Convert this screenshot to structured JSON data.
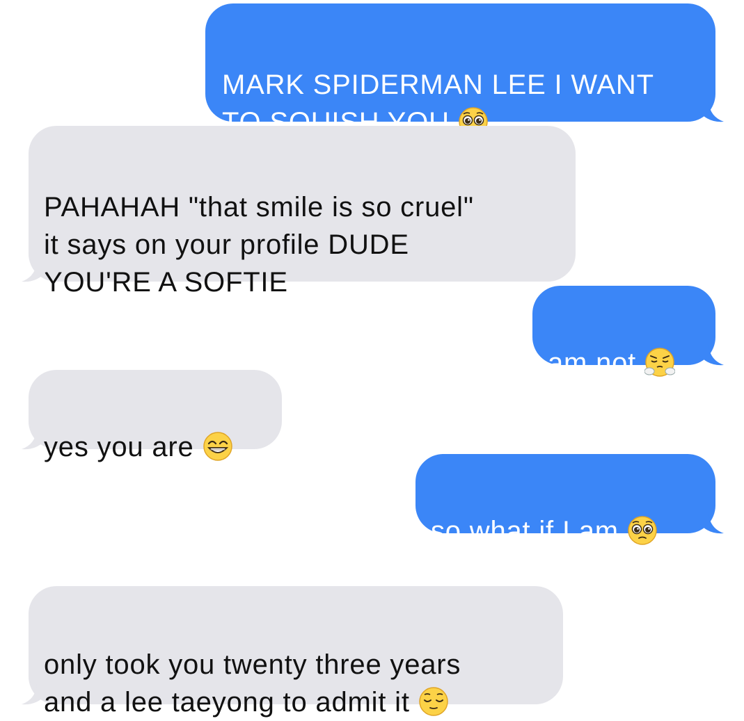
{
  "conversation": {
    "messages": [
      {
        "from": "me",
        "text": "MARK SPIDERMAN LEE I WANT\nTO SQUISH YOU",
        "emoji": "pleading-face-icon"
      },
      {
        "from": "them",
        "text": "PAHAHAH \"that smile is so cruel\"\nit says on your profile DUDE\nYOU'RE A SOFTIE",
        "emoji": ""
      },
      {
        "from": "me",
        "text": "am not",
        "emoji": "face-with-steam-icon"
      },
      {
        "from": "them",
        "text": "yes you are",
        "emoji": "grinning-face-icon"
      },
      {
        "from": "me",
        "text": "so what if I am",
        "emoji": "pleading-face-icon"
      },
      {
        "from": "them",
        "text": "only took you twenty three years\nand a lee taeyong to admit it",
        "emoji": "relieved-face-icon"
      }
    ]
  },
  "colors": {
    "sent_bubble": "#3b86f7",
    "received_bubble": "#e5e5ea",
    "sent_text": "#ffffff",
    "received_text": "#111111"
  }
}
